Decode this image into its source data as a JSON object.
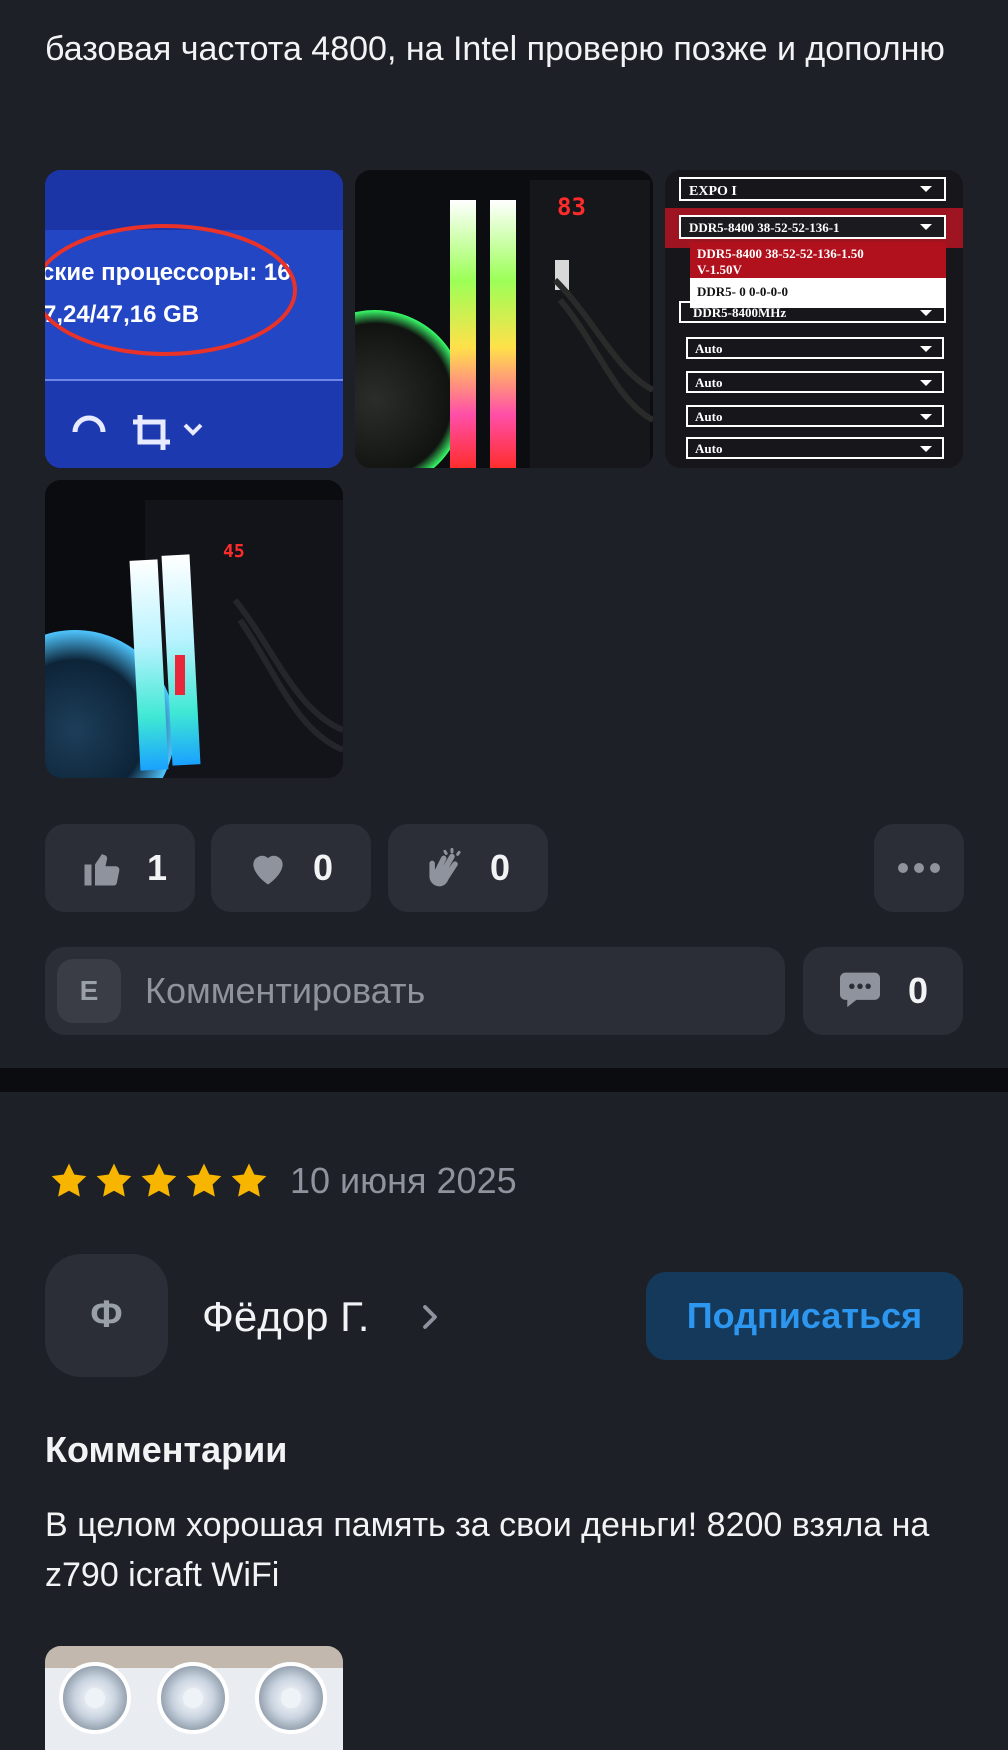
{
  "review": {
    "text_tail": "базовая частота 4800, на Intel проверю позже и дополню",
    "photos": [
      {
        "alt": "Task manager screenshot",
        "lines": [
          "ские процессоры: 16",
          "7,24/47,16 GB"
        ]
      },
      {
        "alt": "RAM modules RGB photo",
        "code": "83"
      },
      {
        "alt": "BIOS EXPO settings",
        "rows": [
          "EXPO I",
          "DDR5-8400 38-52-52-136-1",
          "DDR5-8400 38-52-52-136-1.50",
          "V-1.50V",
          "DDR5-  0 0-0-0-0",
          "DDR5-8400MHz",
          "Auto",
          "Auto",
          "Auto",
          "Auto"
        ]
      },
      {
        "alt": "RAM modules installed photo",
        "code": "45"
      }
    ],
    "reactions": {
      "like": {
        "count": "1",
        "icon": "thumbs-up-icon"
      },
      "heart": {
        "count": "0",
        "icon": "heart-icon"
      },
      "clap": {
        "count": "0",
        "icon": "clap-icon"
      }
    },
    "comment_input": {
      "avatar_letter": "E",
      "placeholder": "Комментировать"
    },
    "comments_count": "0"
  },
  "review2": {
    "rating": 5,
    "date": "10 июня 2025",
    "author": {
      "initial": "Ф",
      "name": "Фёдор Г."
    },
    "subscribe_label": "Подписаться",
    "section_title": "Комментарии",
    "text": "В целом хорошая память за свои деньги! 8200 взяла на z790 icraft WiFi"
  },
  "colors": {
    "background": "#1e2027",
    "card": "#2b2e36",
    "star": "#f7b500",
    "accent": "#2d97f0",
    "accent_bg": "#14395b"
  }
}
